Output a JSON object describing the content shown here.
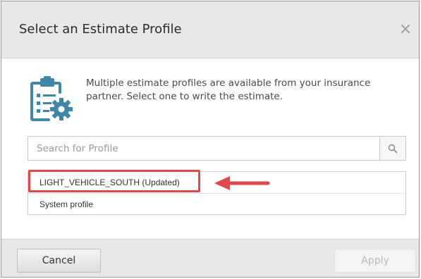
{
  "dialog": {
    "title": "Select an Estimate Profile",
    "close_glyph": "×"
  },
  "intro": {
    "text": "Multiple estimate profiles are available from your insurance partner. Select one to write the estimate."
  },
  "search": {
    "placeholder": "Search for Profile",
    "value": "",
    "icon": "search-icon"
  },
  "profiles": [
    {
      "label": "LIGHT_VEHICLE_SOUTH (Updated)"
    },
    {
      "label": "System profile"
    }
  ],
  "footer": {
    "cancel_label": "Cancel",
    "apply_label": "Apply"
  },
  "colors": {
    "header_bg": "#e8e8e8",
    "icon_blue": "#3f86a8",
    "annotation_red": "#e0484a",
    "disabled_text": "#b9b9b9"
  }
}
